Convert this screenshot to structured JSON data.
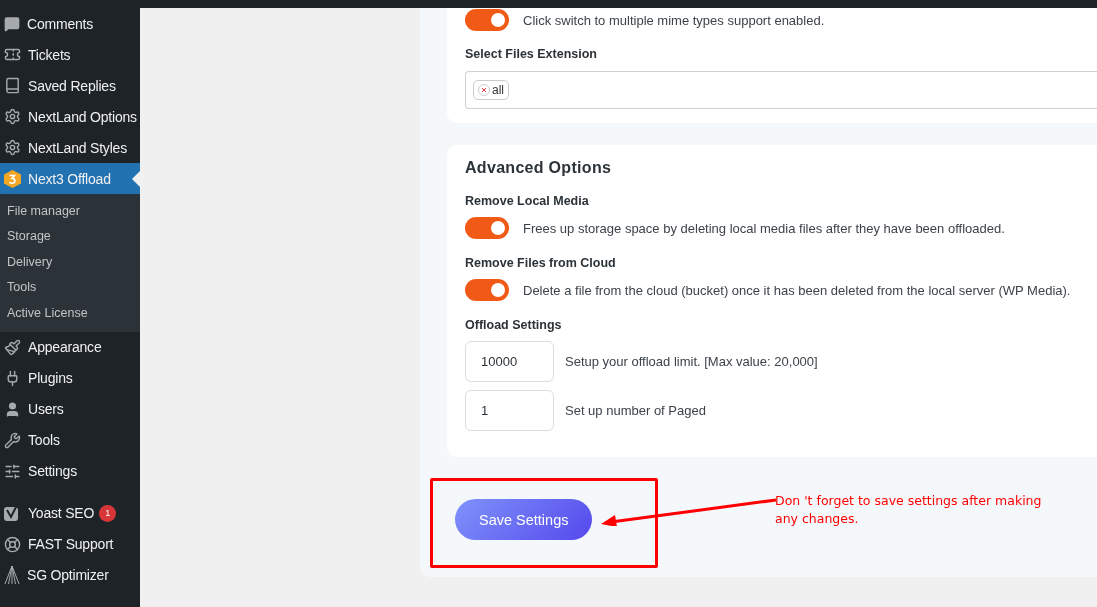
{
  "sidebar": {
    "items": [
      {
        "label": "Comments",
        "selected": false
      },
      {
        "label": "Tickets",
        "selected": false
      },
      {
        "label": "Saved Replies",
        "selected": false
      },
      {
        "label": "NextLand Options",
        "selected": false
      },
      {
        "label": "NextLand Styles",
        "selected": false
      },
      {
        "label": "Next3 Offload",
        "selected": true,
        "children": [
          {
            "label": "File manager",
            "selected": false
          },
          {
            "label": "Storage",
            "selected": false
          },
          {
            "label": "Delivery",
            "selected": false
          },
          {
            "label": "Tools",
            "selected": false
          },
          {
            "label": "Active License",
            "selected": false
          }
        ]
      },
      {
        "label": "Appearance",
        "selected": false
      },
      {
        "label": "Plugins",
        "selected": false
      },
      {
        "label": "Users",
        "selected": false
      },
      {
        "label": "Tools",
        "selected": false
      },
      {
        "label": "Settings",
        "selected": false
      },
      {
        "label": "Yoast SEO",
        "selected": false,
        "group_start": true,
        "badge": "1"
      },
      {
        "label": "FAST Support",
        "selected": false
      },
      {
        "label": "SG Optimizer",
        "selected": false
      }
    ]
  },
  "file_types_card": {
    "toggle": {
      "on": true,
      "description": "Click switch to multiple mime types support enabled."
    },
    "extension_label": "Select Files Extension",
    "extension_tags": [
      "all"
    ]
  },
  "advanced": {
    "title": "Advanced Options",
    "options": [
      {
        "label": "Remove Local Media",
        "on": true,
        "description": "Frees up storage space by deleting local media files after they have been offloaded."
      },
      {
        "label": "Remove Files from Cloud",
        "on": true,
        "description": "Delete a file from the cloud (bucket) once it has been deleted from the local server (WP Media)."
      }
    ],
    "offload_label": "Offload Settings",
    "fields": [
      {
        "value": "10000",
        "hint": "Setup your offload limit. [Max value: 20,000]"
      },
      {
        "value": "1",
        "hint": "Set up number of Paged"
      }
    ]
  },
  "save_button": "Save Settings",
  "annotation": {
    "text": "Don 't forget to save settings after making any changes."
  }
}
